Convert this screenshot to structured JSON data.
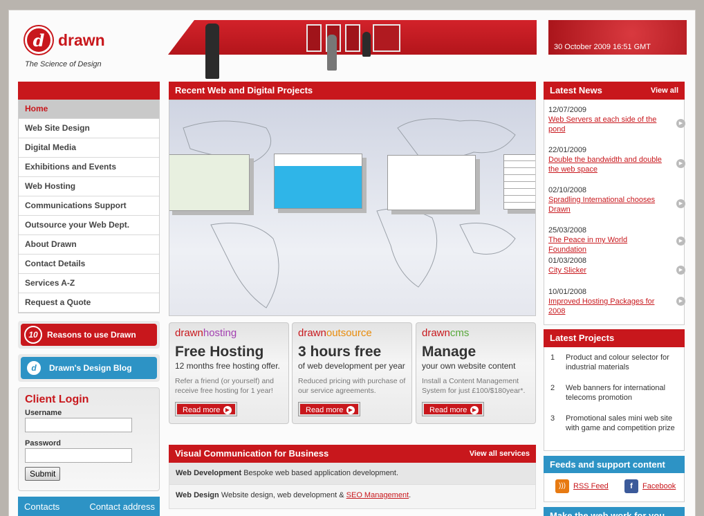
{
  "header": {
    "logo_text": "drawn",
    "tagline": "The Science of Design",
    "datetime": "30 October 2009 16:51 GMT"
  },
  "nav": {
    "items": [
      {
        "label": "Home"
      },
      {
        "label": "Web Site Design"
      },
      {
        "label": "Digital Media"
      },
      {
        "label": "Exhibitions and Events"
      },
      {
        "label": "Web Hosting"
      },
      {
        "label": "Communications Support"
      },
      {
        "label": "Outsource your Web Dept."
      },
      {
        "label": "About Drawn"
      },
      {
        "label": "Contact Details"
      },
      {
        "label": "Services A-Z"
      },
      {
        "label": "Request a Quote"
      }
    ]
  },
  "promos": {
    "reasons_num": "10",
    "reasons_label": "Reasons to use Drawn",
    "blog_label": "Drawn's Design Blog"
  },
  "login": {
    "title": "Client Login",
    "username_label": "Username",
    "password_label": "Password",
    "submit_label": "Submit"
  },
  "contacts": {
    "label": "Contacts",
    "address_label": "Contact address"
  },
  "projects_panel": {
    "title": "Recent Web and Digital Projects"
  },
  "cards": [
    {
      "brand_a": "drawn",
      "brand_b": "hosting",
      "title": "Free Hosting",
      "subtitle": "12 months free hosting offer.",
      "desc": "Refer a friend (or yourself) and receive free hosting for 1 year!",
      "button": "Read more"
    },
    {
      "brand_a": "drawn",
      "brand_b": "outsource",
      "title": "3 hours free",
      "subtitle": "of web development per year",
      "desc": "Reduced pricing with purchase of our service agreements.",
      "button": "Read more"
    },
    {
      "brand_a": "drawn",
      "brand_b": "cms",
      "title": "Manage",
      "subtitle": "your own website content",
      "desc": "Install a Content Management System for just £100/$180year*.",
      "button": "Read more"
    }
  ],
  "visual_comm": {
    "title": "Visual Communication for Business",
    "view_all": "View all services",
    "rows": [
      {
        "term": "Web Development",
        "text": "Bespoke web based application development."
      },
      {
        "term": "Web Design",
        "text": "Website design, web development &",
        "link": "SEO Management",
        "end": "."
      }
    ]
  },
  "news": {
    "title": "Latest News",
    "view_all": "View all",
    "items": [
      {
        "date": "12/07/2009",
        "headline": "Web Servers at each side of the pond"
      },
      {
        "date": "22/01/2009",
        "headline": "Double the bandwidth and double the web space"
      },
      {
        "date": "02/10/2008",
        "headline": "Spradling International chooses Drawn"
      },
      {
        "date": "25/03/2008",
        "headline": "The Peace in my World Foundation"
      },
      {
        "date": "01/03/2008",
        "headline": "City Slicker"
      },
      {
        "date": "10/01/2008",
        "headline": "Improved Hosting Packages for 2008"
      }
    ]
  },
  "latest_projects": {
    "title": "Latest Projects",
    "items": [
      {
        "num": "1",
        "text": "Product and colour selector for industrial materials"
      },
      {
        "num": "2",
        "text": "Web banners for international telecoms promotion"
      },
      {
        "num": "3",
        "text": "Promotional sales mini web site with game and competition prize"
      }
    ]
  },
  "feeds": {
    "title": "Feeds and support content",
    "rss": "RSS Feed",
    "facebook": "Facebook"
  },
  "bottom_right": {
    "title": "Make the web work for you"
  }
}
